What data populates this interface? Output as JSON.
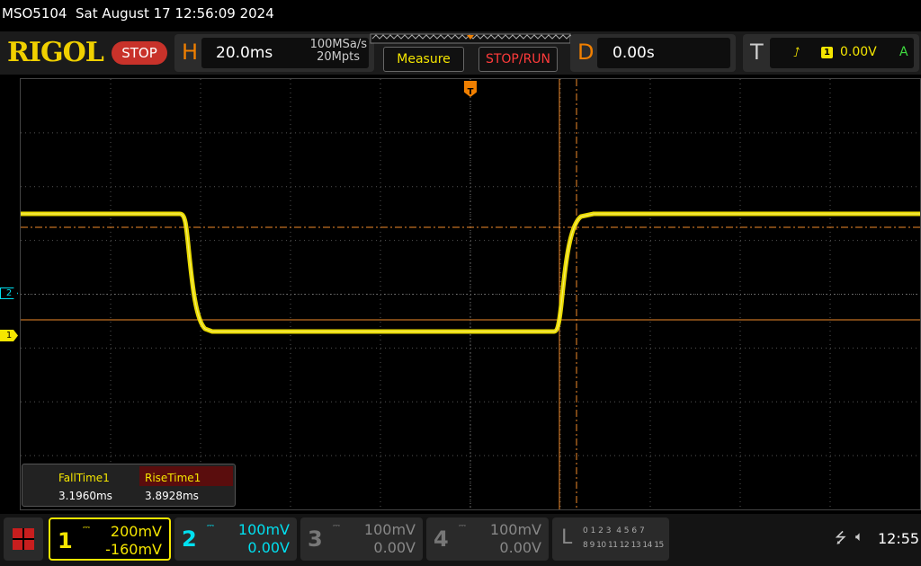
{
  "titlebar": {
    "text": "MSO5104  Sat August 17 12:56:09 2024"
  },
  "header": {
    "logo": "RIGOL",
    "run_state": "STOP",
    "horizontal": {
      "letter": "H",
      "timebase": "20.0ms",
      "sample_rate": "100MSa/s",
      "memory_depth": "20Mpts"
    },
    "measure_label": "Measure",
    "stop_run_label": "STOP/RUN",
    "delay": {
      "letter": "D",
      "value": "0.00s"
    },
    "trigger": {
      "letter": "T",
      "source": "1",
      "level": "0.00V",
      "mode": "A"
    }
  },
  "markers": {
    "trigger_pos": "T",
    "ch2": "2",
    "ch1": "1"
  },
  "measurements": [
    {
      "name": "FallTime1",
      "value": "3.1960ms"
    },
    {
      "name": "RiseTime1",
      "value": "3.8928ms"
    }
  ],
  "channels": [
    {
      "num": "1",
      "scale": "200mV",
      "offset": "-160mV",
      "color": "#f5e600",
      "active": true
    },
    {
      "num": "2",
      "scale": "100mV",
      "offset": "0.00V",
      "color": "#00e0f0",
      "active": false
    },
    {
      "num": "3",
      "scale": "100mV",
      "offset": "0.00V",
      "color": "#666666",
      "active": false
    },
    {
      "num": "4",
      "scale": "100mV",
      "offset": "0.00V",
      "color": "#666666",
      "active": false
    }
  ],
  "logic": {
    "letter": "L",
    "row1": "0 1 2 3  4 5 6 7",
    "row2": "8 9 10 11 12 13 14 15"
  },
  "status": {
    "clock": "12:55"
  },
  "colors": {
    "trace": "#f5e600",
    "cursor": "#f08a2a",
    "accent": "#f07f00",
    "ch2": "#00e0f0"
  }
}
